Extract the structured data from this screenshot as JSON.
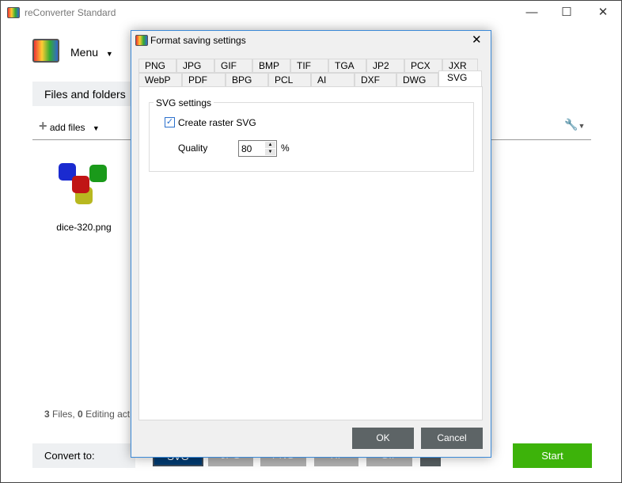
{
  "window": {
    "title": "reConverter Standard",
    "minimize": "—",
    "maximize": "☐",
    "close": "✕"
  },
  "main": {
    "menu_label": "Menu",
    "files_tab": "Files and folders",
    "add_files": "add files",
    "file": {
      "name": "dice-320.png"
    },
    "status": {
      "files_count": "3",
      "files_label": "Files,",
      "edit_count": "0",
      "edit_label": "Editing act"
    },
    "convert_to": "Convert to:",
    "formats": [
      "SVG",
      "JPG",
      "PNG",
      "TIF",
      "GIF",
      "+"
    ],
    "start": "Start"
  },
  "dialog": {
    "title": "Format saving settings",
    "close": "✕",
    "tabs_row1": [
      "PNG",
      "JPG",
      "GIF",
      "BMP",
      "TIF",
      "TGA",
      "JP2",
      "PCX",
      "JXR"
    ],
    "tabs_row2": [
      "WebP",
      "PDF",
      "BPG",
      "PCL",
      "AI",
      "DXF",
      "DWG",
      "SVG"
    ],
    "active_tab": "SVG",
    "group_title": "SVG settings",
    "checkbox_label": "Create raster SVG",
    "checkbox_checked": true,
    "quality_label": "Quality",
    "quality_value": "80",
    "quality_unit": "%",
    "ok": "OK",
    "cancel": "Cancel"
  },
  "colors": {
    "start": "#3db30a",
    "selected_format": "#003a70",
    "button": "#5d6466",
    "accent": "#3c8ad8"
  }
}
